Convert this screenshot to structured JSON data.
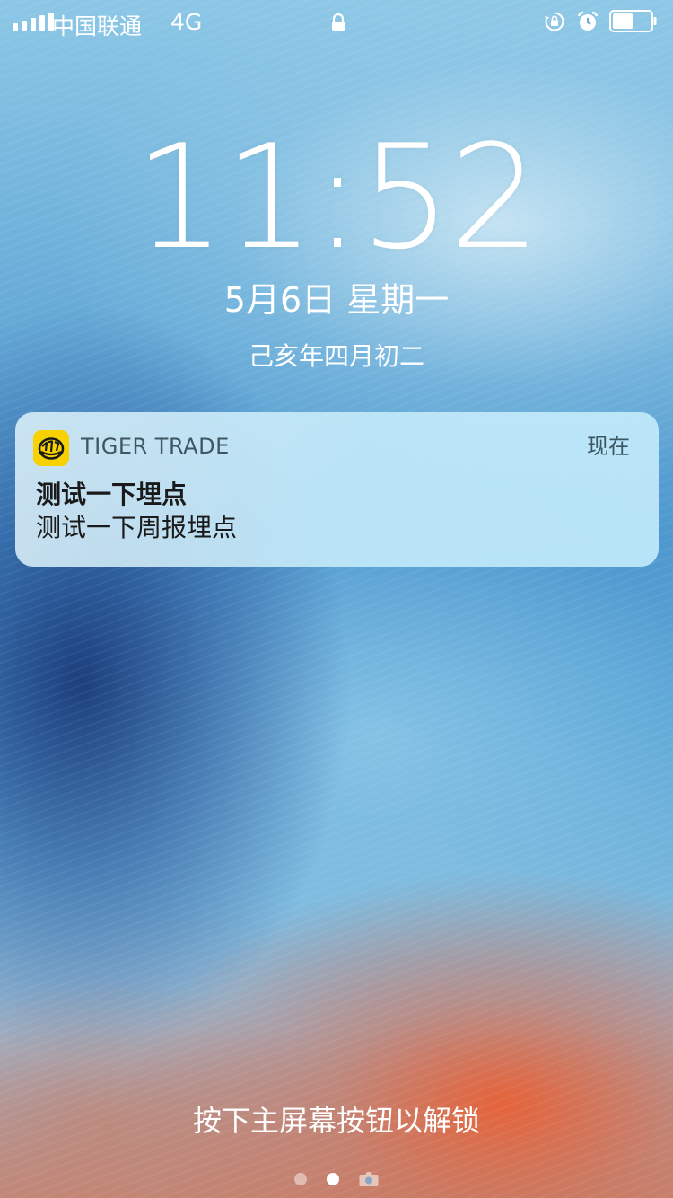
{
  "colors": {
    "notification_bg": "#cdeefb",
    "app_icon_yellow": "#f7d200",
    "text_white": "#ffffff"
  },
  "status_bar": {
    "carrier": "中国联通",
    "network": "4G",
    "signal_bars": 5,
    "battery_level": 0.5,
    "icons": [
      "signal-icon",
      "lock-icon",
      "rotation-lock-icon",
      "alarm-icon",
      "battery-icon"
    ]
  },
  "lock_screen": {
    "time": "11:52",
    "date": "5月6日 星期一",
    "lunar_date": "己亥年四月初二",
    "unlock_hint": "按下主屏幕按钮以解锁",
    "page_count": 3,
    "active_page": 1
  },
  "notification": {
    "app_icon": "tiger-trade-icon",
    "app_name": "TIGER TRADE",
    "time": "现在",
    "title": "测试一下埋点",
    "body": "测试一下周报埋点"
  }
}
